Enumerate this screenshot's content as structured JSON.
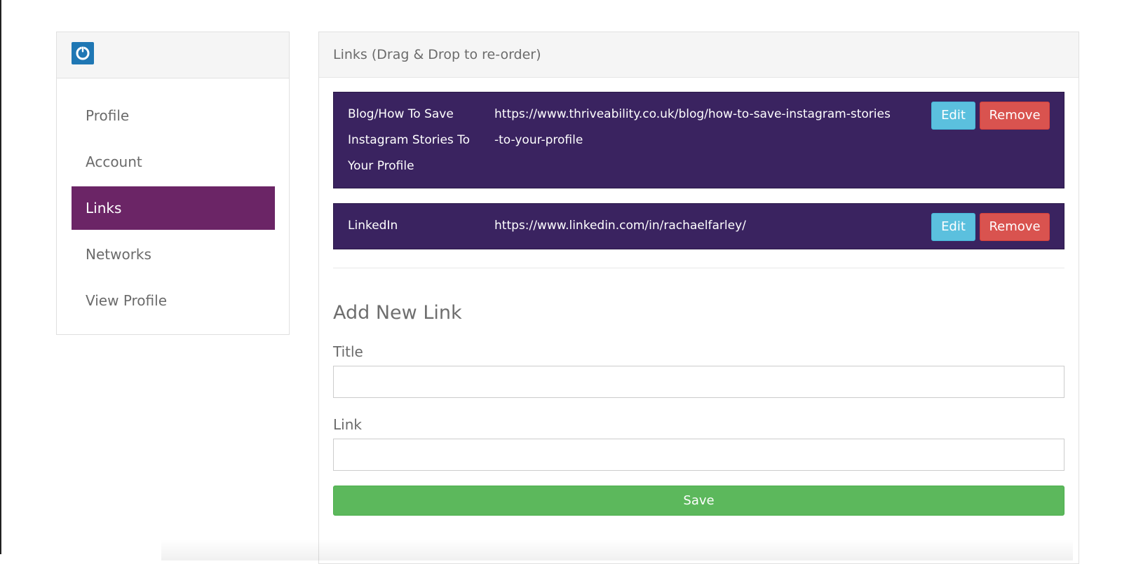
{
  "sidebar": {
    "logo_icon": "power-icon",
    "items": [
      {
        "label": "Profile"
      },
      {
        "label": "Account"
      },
      {
        "label": "Links",
        "active": true
      },
      {
        "label": "Networks"
      },
      {
        "label": "View Profile"
      }
    ]
  },
  "panel": {
    "title": "Links (Drag & Drop to re-order)",
    "links": [
      {
        "title": "Blog/How To Save Instagram Stories To Your Profile",
        "url": "https://www.thriveability.co.uk/blog/how-to-save-instagram-stories-to-your-profile",
        "edit_label": "Edit",
        "remove_label": "Remove"
      },
      {
        "title": "LinkedIn",
        "url": "https://www.linkedin.com/in/rachaelfarley/",
        "edit_label": "Edit",
        "remove_label": "Remove"
      }
    ],
    "form": {
      "heading": "Add New Link",
      "title_label": "Title",
      "title_value": "",
      "link_label": "Link",
      "link_value": "",
      "save_label": "Save"
    }
  },
  "colors": {
    "active_nav": "#6b2566",
    "link_row": "#3a2360",
    "edit_button": "#5bc0de",
    "remove_button": "#d9534f",
    "save_button": "#5cb85c",
    "logo": "#1f77b4"
  }
}
